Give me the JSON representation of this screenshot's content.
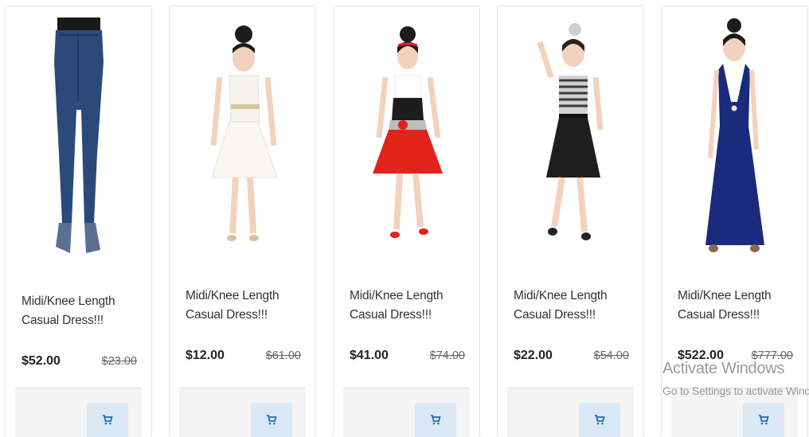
{
  "products": [
    {
      "title": "Midi/Knee Length Casual Dress!!!",
      "price": "$52.00",
      "old_price": "$23.00",
      "image": "denim-jeans",
      "colors": {
        "main": "#2b4a7a",
        "top": "#1a1a1a"
      }
    },
    {
      "title": "Midi/Knee Length Casual Dress!!!",
      "price": "$12.00",
      "old_price": "$61.00",
      "image": "white-frock",
      "colors": {
        "main": "#f6f4ef",
        "top": "#f6f4ef"
      }
    },
    {
      "title": "Midi/Knee Length Casual Dress!!!",
      "price": "$41.00",
      "old_price": "$74.00",
      "image": "red-black-frock",
      "colors": {
        "main": "#e2231a",
        "top": "#1d1d1d"
      }
    },
    {
      "title": "Midi/Knee Length Casual Dress!!!",
      "price": "$22.00",
      "old_price": "$54.00",
      "image": "striped-black-dress",
      "colors": {
        "main": "#1e1e1e",
        "top": "#6e6e6e"
      }
    },
    {
      "title": "Midi/Knee Length Casual Dress!!!",
      "price": "$522.00",
      "old_price": "$777.00",
      "image": "navy-gown",
      "colors": {
        "main": "#1a2a7d",
        "top": "#1a2a7d"
      }
    }
  ],
  "cart_icon": "cart-icon",
  "accent": "#dbe9f7",
  "watermark": {
    "line1": "Activate Windows",
    "line2": "Go to Settings to activate Window"
  }
}
